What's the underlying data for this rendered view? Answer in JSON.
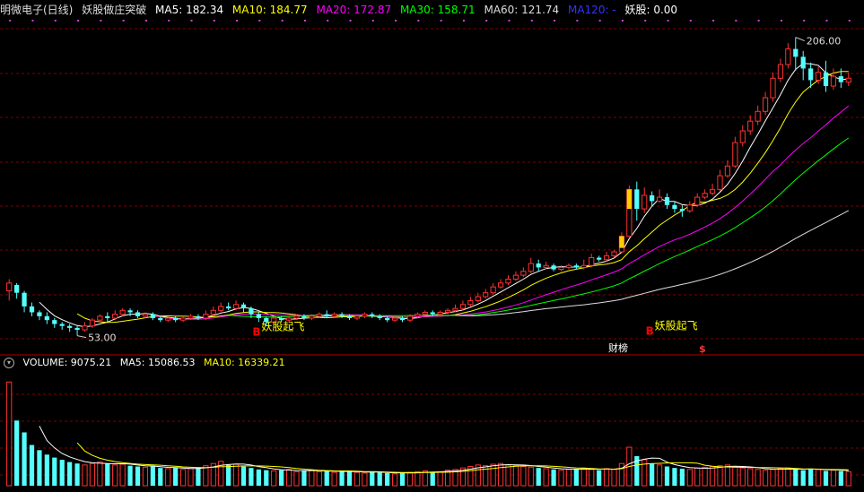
{
  "header": {
    "stock": "明微电子(日线)",
    "indicator": "妖股做庄突破",
    "ma5": {
      "label": "MA5: 182.34",
      "color": "#ffffff"
    },
    "ma10": {
      "label": "MA10: 184.77",
      "color": "#ffff00"
    },
    "ma20": {
      "label": "MA20: 172.87",
      "color": "#ff00ff"
    },
    "ma30": {
      "label": "MA30: 158.71",
      "color": "#00ff00"
    },
    "ma60": {
      "label": "MA60: 121.74",
      "color": "#dddddd"
    },
    "ma120": {
      "label": "MA120: -",
      "color": "#3333ff"
    },
    "yaogu": {
      "label": "妖股: 0.00",
      "color": "#ffffff"
    }
  },
  "volume_header": {
    "icon": "collapse-icon",
    "volume": {
      "label": "VOLUME: 9075.21",
      "color": "#ffffff"
    },
    "ma5": {
      "label": "MA5: 15086.53",
      "color": "#ffffff"
    },
    "ma10": {
      "label": "MA10: 16339.21",
      "color": "#ffff00"
    }
  },
  "annotations": {
    "high": "206.00",
    "low": "53.00",
    "signal_text": "妖股起飞",
    "signal_letter": "B",
    "event1": "财榜",
    "event2": "$"
  },
  "colors": {
    "up": "#ff3232",
    "down": "#54ffff",
    "grid": "#800000",
    "signal": "#ffff00",
    "signal_letter": "#ff0000"
  },
  "chart_data": {
    "type": "candlestick",
    "y_range": [
      45,
      215
    ],
    "candles": [
      [
        76,
        80,
        82,
        71
      ],
      [
        79,
        75,
        80,
        72
      ],
      [
        75,
        68,
        76,
        65
      ],
      [
        68,
        65,
        70,
        63
      ],
      [
        65,
        63,
        66,
        61
      ],
      [
        63,
        61,
        65,
        59
      ],
      [
        61,
        59,
        62,
        57
      ],
      [
        59,
        58,
        60,
        56
      ],
      [
        58,
        57,
        59,
        55
      ],
      [
        57,
        56,
        58,
        53
      ],
      [
        56,
        58,
        60,
        55
      ],
      [
        58,
        61,
        62,
        57
      ],
      [
        61,
        63,
        64,
        60
      ],
      [
        63,
        62,
        65,
        60
      ],
      [
        62,
        64,
        66,
        61
      ],
      [
        64,
        66,
        67,
        63
      ],
      [
        66,
        65,
        67,
        63
      ],
      [
        65,
        63,
        66,
        62
      ],
      [
        63,
        64,
        65,
        62
      ],
      [
        64,
        62,
        65,
        61
      ],
      [
        62,
        61,
        63,
        60
      ],
      [
        61,
        62,
        63,
        60
      ],
      [
        62,
        61,
        63,
        60
      ],
      [
        61,
        62,
        63,
        60
      ],
      [
        62,
        63,
        64,
        61
      ],
      [
        63,
        62,
        64,
        61
      ],
      [
        62,
        64,
        66,
        61
      ],
      [
        64,
        66,
        68,
        63
      ],
      [
        66,
        68,
        70,
        65
      ],
      [
        68,
        67,
        70,
        66
      ],
      [
        67,
        69,
        71,
        66
      ],
      [
        69,
        67,
        70,
        65
      ],
      [
        67,
        64,
        68,
        62
      ],
      [
        64,
        62,
        65,
        60
      ],
      [
        62,
        60,
        63,
        58
      ],
      [
        60,
        62,
        63,
        59
      ],
      [
        62,
        61,
        63,
        60
      ],
      [
        61,
        62,
        63,
        60
      ],
      [
        62,
        63,
        64,
        61
      ],
      [
        63,
        62,
        64,
        61
      ],
      [
        62,
        63,
        64,
        61
      ],
      [
        63,
        64,
        65,
        62
      ],
      [
        64,
        63,
        66,
        62
      ],
      [
        63,
        64,
        65,
        62
      ],
      [
        64,
        63,
        65,
        62
      ],
      [
        63,
        62,
        64,
        61
      ],
      [
        62,
        63,
        64,
        61
      ],
      [
        63,
        64,
        65,
        62
      ],
      [
        64,
        63,
        65,
        62
      ],
      [
        63,
        62,
        64,
        61
      ],
      [
        62,
        61,
        63,
        60
      ],
      [
        61,
        62,
        63,
        60
      ],
      [
        62,
        61,
        63,
        60
      ],
      [
        61,
        63,
        64,
        60
      ],
      [
        63,
        64,
        65,
        62
      ],
      [
        64,
        65,
        66,
        63
      ],
      [
        65,
        64,
        66,
        63
      ],
      [
        64,
        65,
        66,
        63
      ],
      [
        65,
        66,
        67,
        64
      ],
      [
        66,
        67,
        69,
        65
      ],
      [
        67,
        69,
        71,
        66
      ],
      [
        69,
        71,
        73,
        68
      ],
      [
        71,
        73,
        75,
        70
      ],
      [
        73,
        75,
        77,
        72
      ],
      [
        75,
        78,
        80,
        74
      ],
      [
        78,
        80,
        82,
        77
      ],
      [
        80,
        82,
        84,
        79
      ],
      [
        82,
        84,
        86,
        81
      ],
      [
        84,
        86,
        88,
        83
      ],
      [
        86,
        90,
        93,
        85
      ],
      [
        90,
        88,
        92,
        86
      ],
      [
        88,
        89,
        91,
        87
      ],
      [
        89,
        87,
        90,
        86
      ],
      [
        87,
        88,
        89,
        86
      ],
      [
        88,
        89,
        90,
        87
      ],
      [
        89,
        88,
        90,
        87
      ],
      [
        88,
        89,
        92,
        87
      ],
      [
        89,
        93,
        95,
        88
      ],
      [
        93,
        92,
        94,
        91
      ],
      [
        92,
        94,
        96,
        91
      ],
      [
        94,
        96,
        97,
        93
      ],
      [
        96,
        104,
        106,
        95
      ],
      [
        104,
        128,
        130,
        104
      ],
      [
        128,
        118,
        132,
        112
      ],
      [
        118,
        125,
        129,
        116
      ],
      [
        125,
        122,
        127,
        119
      ],
      [
        122,
        124,
        128,
        121
      ],
      [
        124,
        120,
        126,
        118
      ],
      [
        120,
        118,
        122,
        116
      ],
      [
        118,
        117,
        120,
        114
      ],
      [
        117,
        120,
        122,
        116
      ],
      [
        120,
        124,
        126,
        119
      ],
      [
        124,
        126,
        128,
        123
      ],
      [
        126,
        128,
        131,
        125
      ],
      [
        128,
        135,
        138,
        127
      ],
      [
        135,
        140,
        143,
        134
      ],
      [
        140,
        152,
        155,
        139
      ],
      [
        152,
        158,
        161,
        150
      ],
      [
        158,
        163,
        166,
        156
      ],
      [
        163,
        168,
        171,
        161
      ],
      [
        168,
        175,
        178,
        166
      ],
      [
        175,
        185,
        188,
        173
      ],
      [
        185,
        192,
        195,
        183
      ],
      [
        192,
        200,
        203,
        190
      ],
      [
        200,
        196,
        206,
        189
      ],
      [
        196,
        190,
        199,
        184
      ],
      [
        190,
        184,
        193,
        180
      ],
      [
        184,
        188,
        191,
        182
      ],
      [
        188,
        181,
        194,
        178
      ],
      [
        181,
        186,
        190,
        179
      ],
      [
        186,
        183,
        190,
        180
      ],
      [
        183,
        185,
        188,
        181
      ]
    ],
    "volume": [
      140,
      88,
      72,
      55,
      48,
      42,
      38,
      35,
      32,
      30,
      28,
      30,
      32,
      30,
      28,
      29,
      27,
      26,
      25,
      26,
      24,
      23,
      24,
      22,
      23,
      25,
      27,
      30,
      33,
      28,
      29,
      26,
      24,
      22,
      21,
      20,
      21,
      22,
      19,
      20,
      21,
      19,
      20,
      18,
      19,
      20,
      18,
      17,
      19,
      18,
      17,
      16,
      17,
      18,
      19,
      20,
      18,
      19,
      21,
      22,
      24,
      26,
      28,
      27,
      29,
      30,
      28,
      27,
      26,
      25,
      24,
      23,
      22,
      21,
      22,
      23,
      24,
      22,
      21,
      23,
      22,
      30,
      52,
      40,
      35,
      30,
      28,
      26,
      24,
      23,
      22,
      24,
      25,
      26,
      27,
      28,
      25,
      24,
      23,
      22,
      21,
      22,
      23,
      24,
      22,
      21,
      23,
      22,
      20,
      21,
      20,
      19
    ],
    "volume_range": [
      0,
      150
    ]
  }
}
